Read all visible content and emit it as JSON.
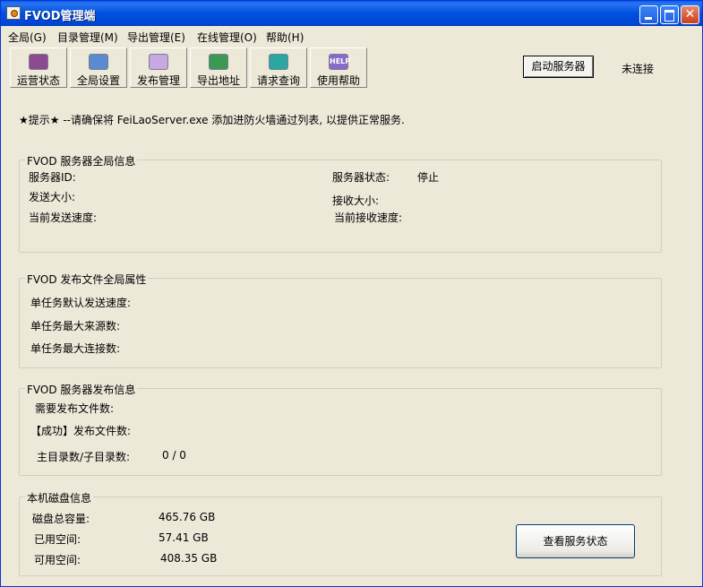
{
  "window": {
    "title": "FVOD管理端"
  },
  "menu": [
    {
      "label": "全局(G)"
    },
    {
      "label": "目录管理(M)"
    },
    {
      "label": "导出管理(E)"
    },
    {
      "label": "在线管理(O)"
    },
    {
      "label": "帮助(H)"
    }
  ],
  "toolbar": [
    {
      "label": "运营状态",
      "icon": "monitor-icon",
      "color": "#8E4A8E"
    },
    {
      "label": "全局设置",
      "icon": "settings-icon",
      "color": "#5A8AD0"
    },
    {
      "label": "发布管理",
      "icon": "publish-icon",
      "color": "#C8A8E0"
    },
    {
      "label": "导出地址",
      "icon": "export-icon",
      "color": "#3A9A50"
    },
    {
      "label": "请求查询",
      "icon": "query-icon",
      "color": "#2AA8A0"
    },
    {
      "label": "使用帮助",
      "icon": "help-icon",
      "icon_text": "HELP",
      "color": "#8A6AC8"
    }
  ],
  "server": {
    "start_label": "启动服务器",
    "connection_status": "未连接"
  },
  "hint": "★提示★ --请确保将 FeiLaoServer.exe  添加进防火墙通过列表, 以提供正常服务.",
  "server_info": {
    "title": "FVOD 服务器全局信息",
    "server_id_label": "服务器ID:",
    "server_status_label": "服务器状态:",
    "server_status_value": "停止",
    "sent_size_label": "发送大小:",
    "recv_size_label": "接收大小:",
    "send_speed_label": "当前发送速度:",
    "recv_speed_label": "当前接收速度:"
  },
  "publish_props": {
    "title": "FVOD 发布文件全局属性",
    "default_speed_label": "单任务默认发送速度:",
    "max_sources_label": "单任务最大来源数:",
    "max_connections_label": "单任务最大连接数:"
  },
  "publish_info": {
    "title": "FVOD 服务器发布信息",
    "files_needed_label": "需要发布文件数:",
    "files_success_label": "【成功】发布文件数:",
    "dirs_label": "主目录数/子目录数:",
    "dirs_value": "0 / 0"
  },
  "disk_info": {
    "title": "本机磁盘信息",
    "total_label": "磁盘总容量:",
    "total_value": "465.76 GB",
    "used_label": "已用空间:",
    "used_value": "57.41 GB",
    "free_label": "可用空间:",
    "free_value": "408.35 GB",
    "status_button": "查看服务状态"
  }
}
